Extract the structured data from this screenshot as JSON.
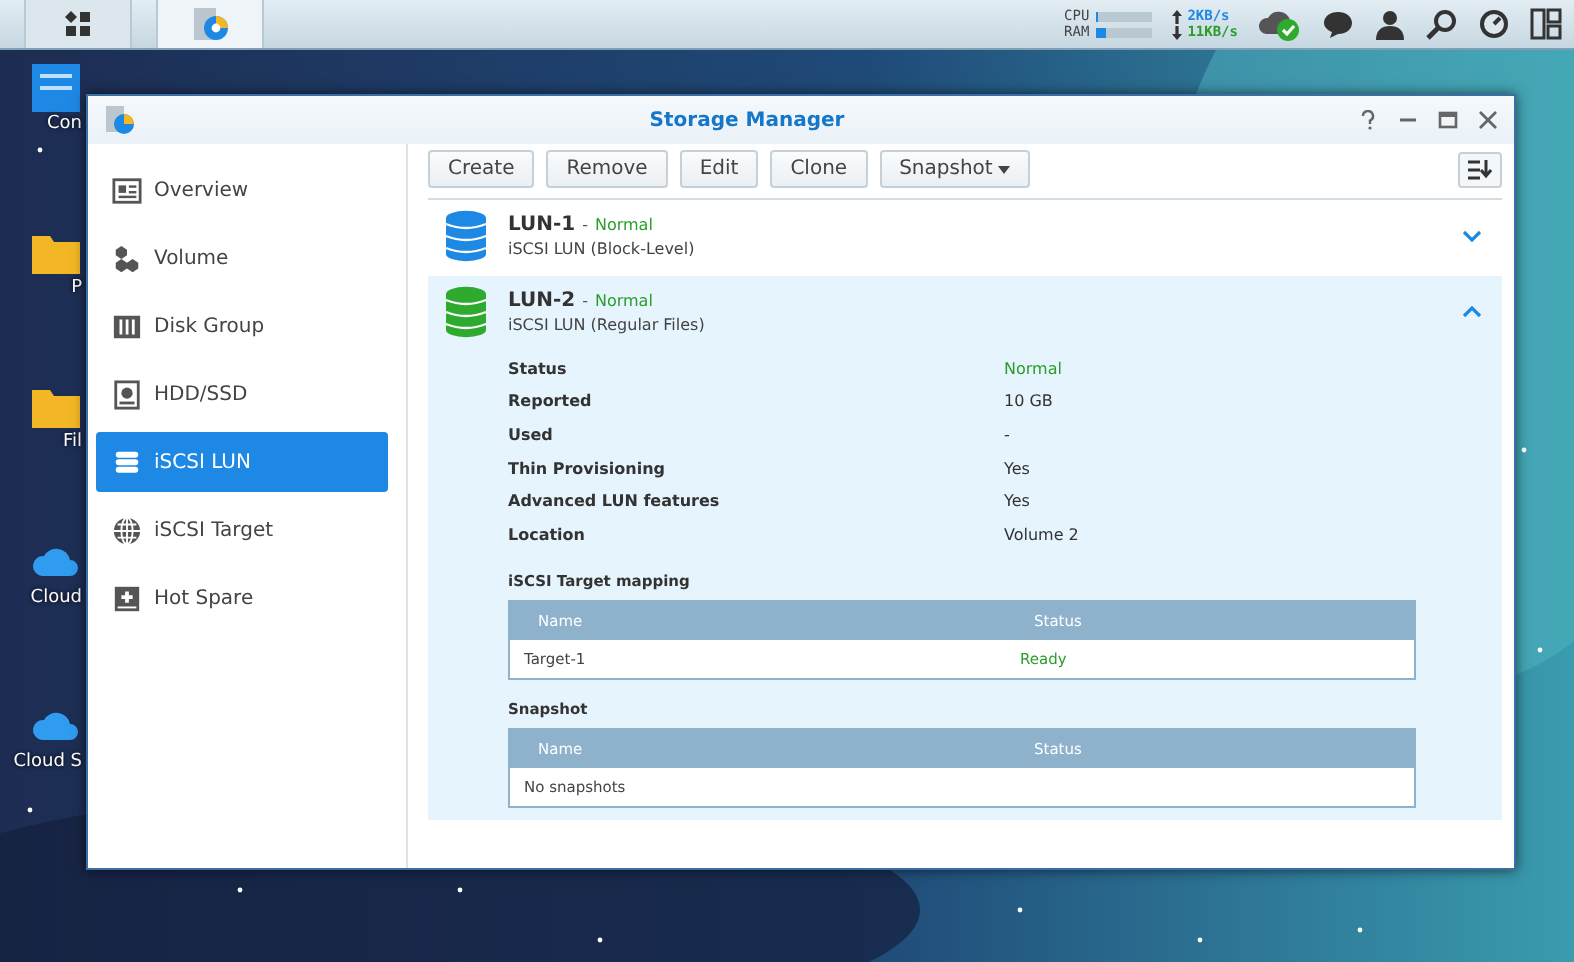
{
  "taskbar": {
    "apps": [
      {
        "kind": "main-menu",
        "selected": false
      },
      {
        "kind": "storage",
        "selected": true
      }
    ],
    "tray": {
      "cpu_label": "CPU",
      "ram_label": "RAM",
      "cpu": {
        "level": 0.05
      },
      "ram": {
        "level": 0.2
      },
      "upload": "2KB/s",
      "download": "11KB/s"
    }
  },
  "desktop_icons": [
    {
      "label": "Con",
      "kind": "panel"
    },
    {
      "label": "P",
      "kind": "folder"
    },
    {
      "label": "Fil",
      "kind": "folder"
    },
    {
      "label": "Cloud",
      "kind": "cloud"
    },
    {
      "label": "Cloud S",
      "kind": "cloud"
    }
  ],
  "window": {
    "title": "Storage Manager"
  },
  "sidebar": {
    "items": [
      {
        "label": "Overview",
        "kind": "overview",
        "selected": false
      },
      {
        "label": "Volume",
        "kind": "volume",
        "selected": false
      },
      {
        "label": "Disk Group",
        "kind": "diskgroup",
        "selected": false
      },
      {
        "label": "HDD/SSD",
        "kind": "hdd",
        "selected": false
      },
      {
        "label": "iSCSI LUN",
        "kind": "lun",
        "selected": true
      },
      {
        "label": "iSCSI Target",
        "kind": "target",
        "selected": false
      },
      {
        "label": "Hot Spare",
        "kind": "spare",
        "selected": false
      }
    ]
  },
  "toolbar": {
    "buttons": [
      {
        "label": "Create",
        "kind": "plain"
      },
      {
        "label": "Remove",
        "kind": "plain"
      },
      {
        "label": "Edit",
        "kind": "plain"
      },
      {
        "label": "Clone",
        "kind": "plain"
      },
      {
        "label": "Snapshot",
        "kind": "dropdown"
      }
    ]
  },
  "luns": [
    {
      "name": "LUN-1",
      "separator": "-",
      "status": "Normal",
      "type": "iSCSI LUN (Block-Level)",
      "color": "#1e88e5",
      "expanded": false
    },
    {
      "name": "LUN-2",
      "separator": "-",
      "status": "Normal",
      "type": "iSCSI LUN (Regular Files)",
      "color": "#2eaa2e",
      "expanded": true,
      "details": [
        {
          "label": "Status",
          "value": "Normal",
          "kind": "status"
        },
        {
          "label": "Reported",
          "value": "10 GB",
          "kind": "text"
        },
        {
          "label": "Used",
          "value": "-",
          "kind": "text"
        },
        {
          "label": "Thin Provisioning",
          "value": "Yes",
          "kind": "text"
        },
        {
          "label": "Advanced LUN features",
          "value": "Yes",
          "kind": "text"
        },
        {
          "label": "Location",
          "value": "Volume 2",
          "kind": "text"
        }
      ],
      "tables": [
        {
          "title": "iSCSI Target mapping",
          "columns": [
            "Name",
            "Status"
          ],
          "rows": [
            {
              "name": "Target-1",
              "status": "Ready"
            }
          ]
        },
        {
          "title": "Snapshot",
          "columns": [
            "Name",
            "Status"
          ],
          "empty_text": "No snapshots"
        }
      ]
    }
  ]
}
